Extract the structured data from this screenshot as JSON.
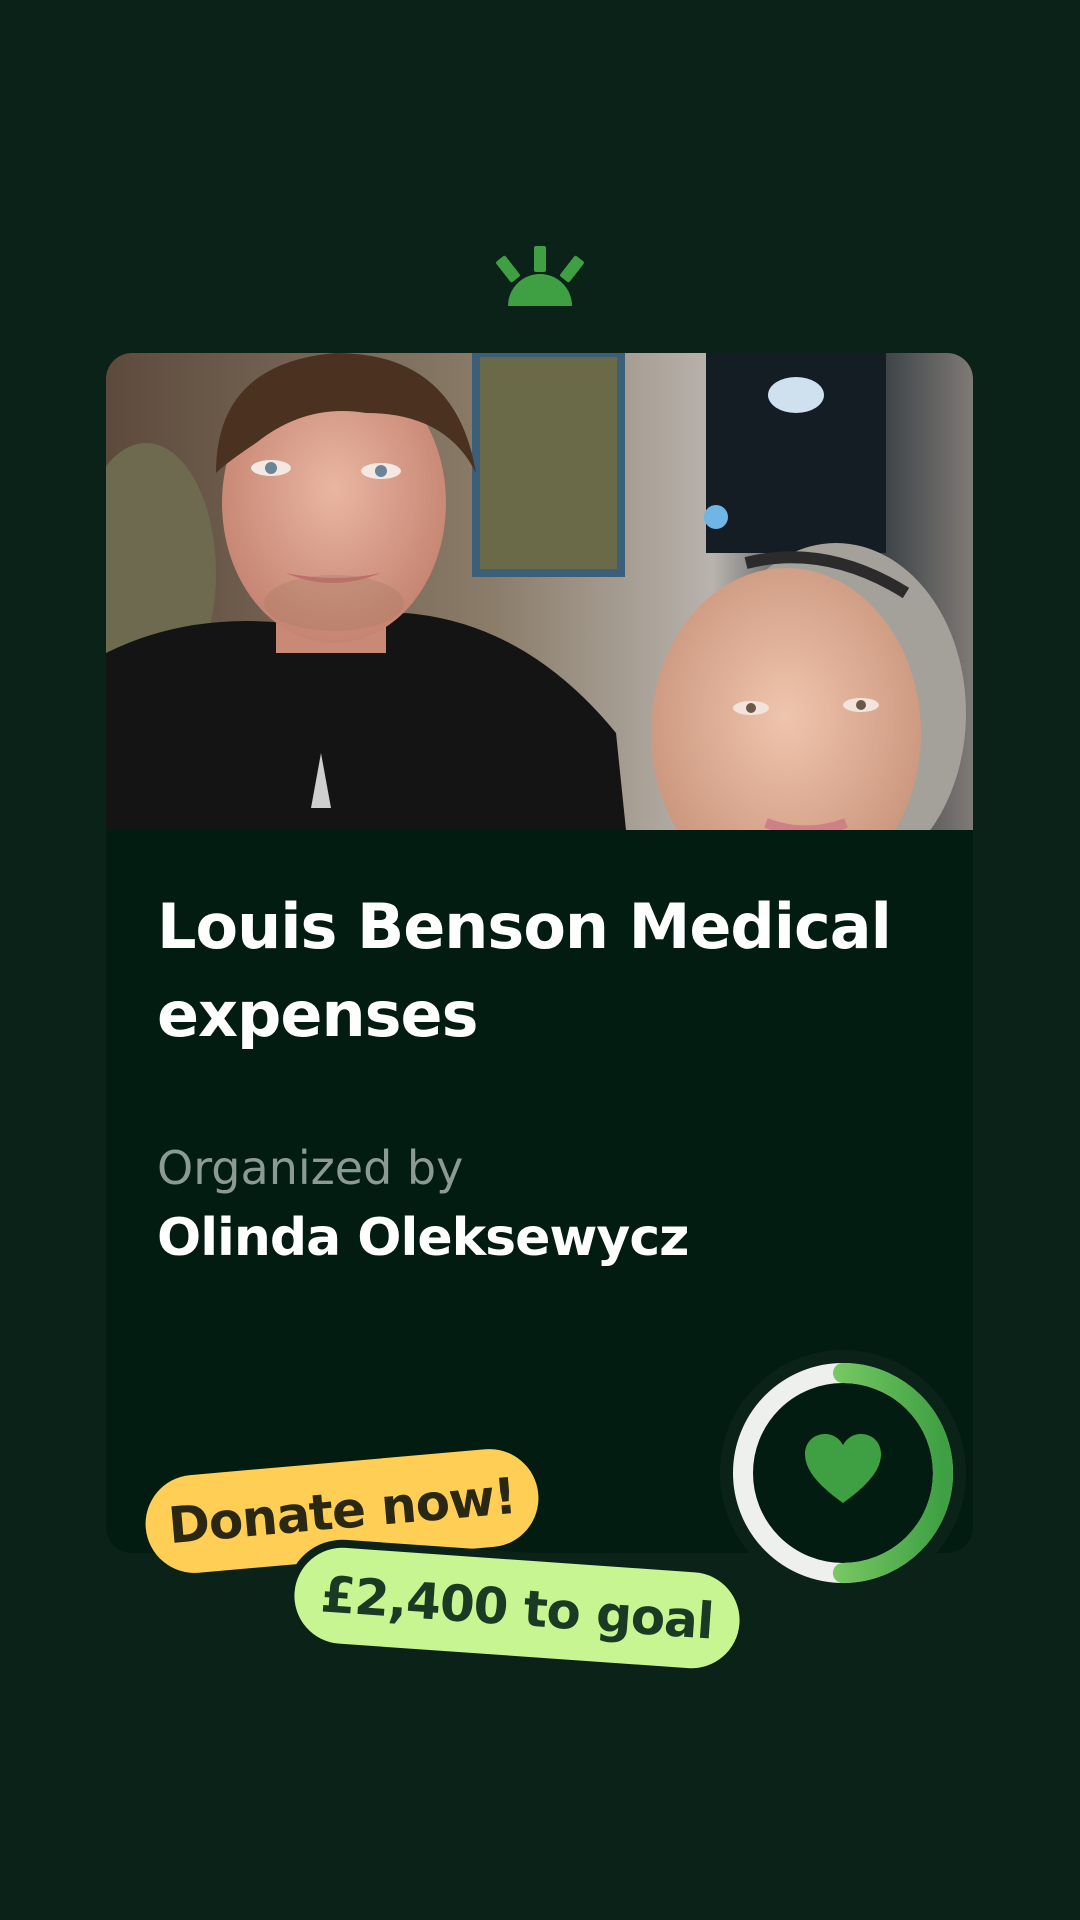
{
  "fundraiser": {
    "title": "Louis Benson Medical expenses",
    "organizer_label": "Organized by",
    "organizer_name": "Olinda Oleksewycz",
    "donate_label": "Donate now!",
    "goal_text": "£2,400 to goal",
    "progress_fraction": 0.5
  },
  "icons": {
    "logo": "sunrise-logo-icon",
    "progress_center": "heart-icon"
  },
  "colors": {
    "background": "#0b2219",
    "card": "#031c12",
    "brand_green": "#3ea043",
    "progress_light": "#9ee07a",
    "donate_yellow": "#fece55",
    "goal_green": "#c6f592"
  }
}
